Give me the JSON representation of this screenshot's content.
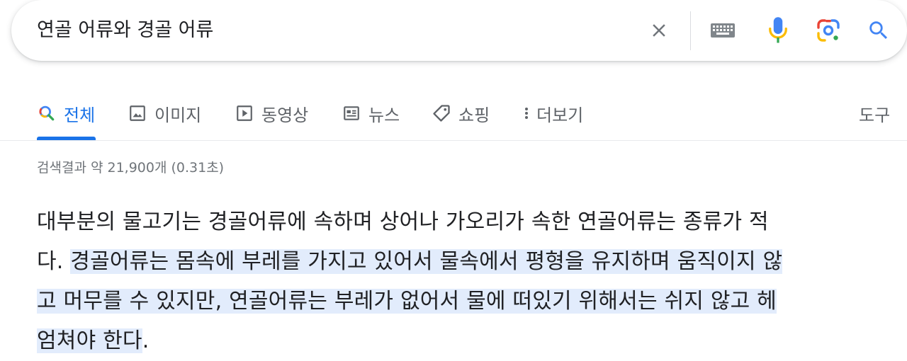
{
  "search": {
    "query": "연골 어류와 경골 어류"
  },
  "icons": {
    "clear": "close-icon",
    "keyboard": "keyboard-icon",
    "mic": "microphone-icon",
    "lens": "lens-camera-icon",
    "search": "search-icon"
  },
  "tabs": [
    {
      "label": "전체",
      "icon": "search-icon",
      "active": true
    },
    {
      "label": "이미지",
      "icon": "image-icon"
    },
    {
      "label": "동영상",
      "icon": "play-icon"
    },
    {
      "label": "뉴스",
      "icon": "news-icon"
    },
    {
      "label": "쇼핑",
      "icon": "tag-icon"
    },
    {
      "label": "더보기",
      "icon": "more-vertical-icon"
    }
  ],
  "tools_label": "도구",
  "result_stats": "검색결과 약 21,900개 (0.31초)",
  "snippet": {
    "line1": "대부분의 물고기는 경골어류에 속하며 상어나 가오리가 속한 연골어류는 종류가 적",
    "line2_plain": "다. ",
    "line2_hl": "경골어류는 몸속에 부레를 가지고 있어서 물속에서 평형을 유지하며 움직이지 않",
    "line3_hl": "고 머무를 수 있지만, 연골어류는 부레가 없어서 물에 떠있기 위해서는 쉬지 않고 헤",
    "line4_hl": "엄쳐야 한다",
    "line4_plain": "."
  },
  "colors": {
    "accent": "#1a73e8",
    "highlight": "#e2ecfc",
    "muted_text": "#70757a"
  }
}
